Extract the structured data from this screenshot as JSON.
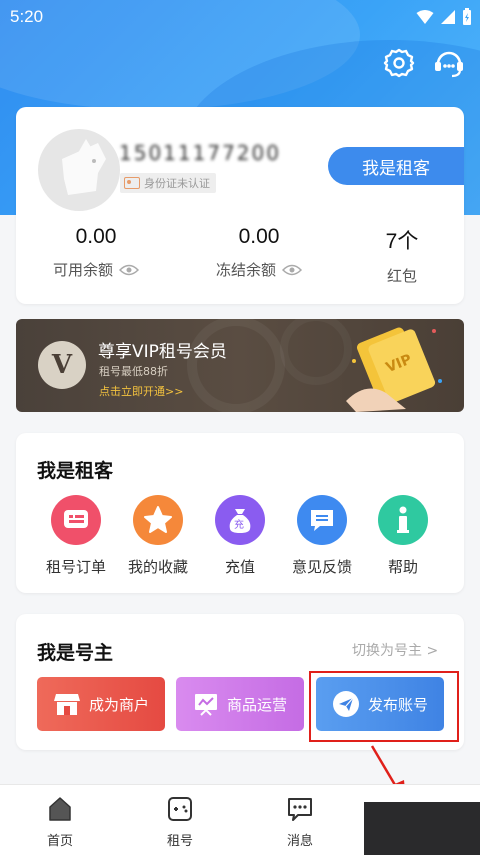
{
  "status_bar": {
    "time": "5:20"
  },
  "profile": {
    "username": "15011177200",
    "id_status": "身份证未认证",
    "role_button": "我是租客",
    "stats": [
      {
        "value": "0.00",
        "label": "可用余额"
      },
      {
        "value": "0.00",
        "label": "冻结余额"
      },
      {
        "value": "7个",
        "label": "红包"
      }
    ]
  },
  "vip": {
    "logo_letter": "V",
    "title": "尊享VIP租号会员",
    "subtitle": "租号最低88折",
    "cta": "点击立即开通>>"
  },
  "tenant_section": {
    "title": "我是租客",
    "items": [
      {
        "label": "租号订单",
        "icon": "order-icon",
        "color": "#f0506a"
      },
      {
        "label": "我的收藏",
        "icon": "star-icon",
        "color": "#f5883a"
      },
      {
        "label": "充值",
        "icon": "moneybag-icon",
        "color": "#8a5cf0"
      },
      {
        "label": "意见反馈",
        "icon": "feedback-icon",
        "color": "#3e8af0"
      },
      {
        "label": "帮助",
        "icon": "info-icon",
        "color": "#2fc9a0"
      }
    ]
  },
  "owner_section": {
    "title": "我是号主",
    "switch_label": "切换为号主 >",
    "buttons": [
      {
        "label": "成为商户",
        "icon": "store-icon",
        "color": "#ef5a4e"
      },
      {
        "label": "商品运营",
        "icon": "chart-board-icon",
        "color": "#cf7ae8"
      },
      {
        "label": "发布账号",
        "icon": "paper-plane-icon",
        "color": "#4a90e8"
      }
    ]
  },
  "bottom_nav": [
    {
      "label": "首页",
      "icon": "home-icon"
    },
    {
      "label": "租号",
      "icon": "gamepad-icon"
    },
    {
      "label": "消息",
      "icon": "message-icon"
    }
  ],
  "colors": {
    "brand_blue": "#3d8bed",
    "highlight_red": "#e0201a"
  }
}
